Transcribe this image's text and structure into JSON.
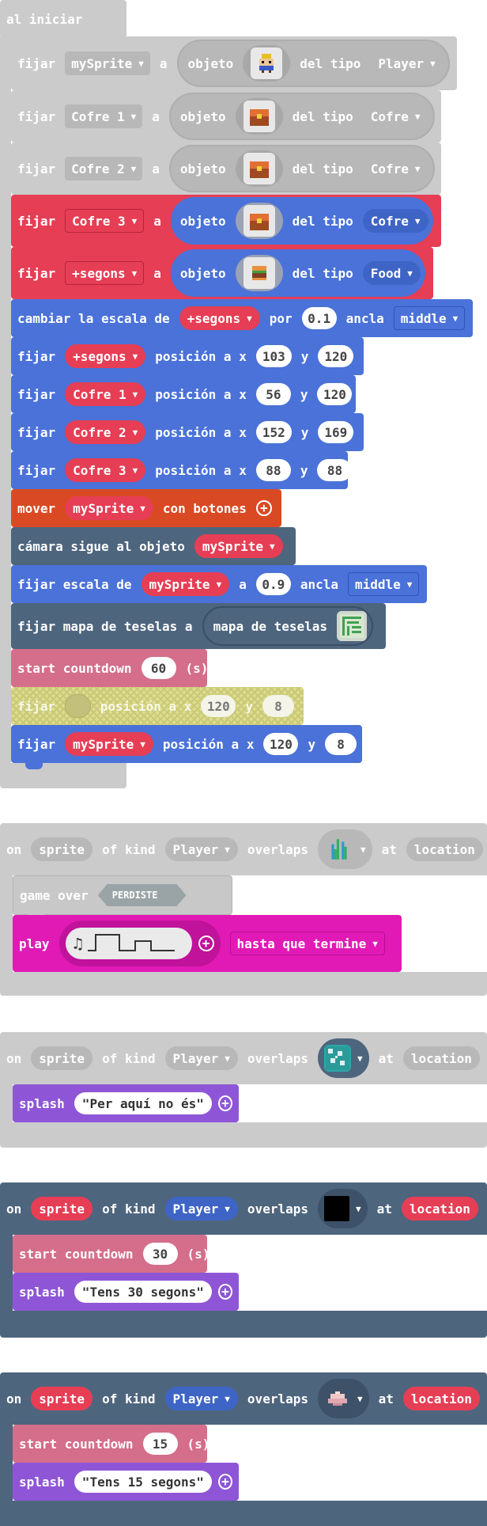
{
  "theme": {
    "disabled_gray": "#cbcbcb",
    "sprites_red": "#e63e55",
    "sprites_blue": "#4a72d8",
    "controller_orange": "#d94a24",
    "scene_slate": "#4e657e",
    "info_pink": "#d46e8a",
    "music_magenta": "#e11ab6",
    "splash_purple": "#8e56d6"
  },
  "on_start": {
    "label": "al iniciar",
    "blocks": [
      {
        "set": "fijar",
        "var": "mySprite",
        "to": "a",
        "obj": "objeto",
        "kind_label": "del tipo",
        "kind": "Player",
        "image": "player-sprite-icon"
      },
      {
        "set": "fijar",
        "var": "Cofre 1",
        "to": "a",
        "obj": "objeto",
        "kind_label": "del tipo",
        "kind": "Cofre",
        "image": "chest-icon"
      },
      {
        "set": "fijar",
        "var": "Cofre 2",
        "to": "a",
        "obj": "objeto",
        "kind_label": "del tipo",
        "kind": "Cofre",
        "image": "chest-icon"
      },
      {
        "set": "fijar",
        "var": "Cofre 3",
        "to": "a",
        "obj": "objeto",
        "kind_label": "del tipo",
        "kind": "Cofre",
        "image": "chest-icon"
      },
      {
        "set": "fijar",
        "var": "+segons",
        "to": "a",
        "obj": "objeto",
        "kind_label": "del tipo",
        "kind": "Food",
        "image": "burger-icon"
      }
    ],
    "scale": {
      "label": "cambiar la escala de",
      "var": "+segons",
      "by": "por",
      "value": "0.1",
      "anchor_label": "ancla",
      "anchor": "middle"
    },
    "positions": [
      {
        "set": "fijar",
        "var": "+segons",
        "label": "posición a x",
        "x": "103",
        "y_label": "y",
        "y": "120"
      },
      {
        "set": "fijar",
        "var": "Cofre 1",
        "label": "posición a x",
        "x": "56",
        "y_label": "y",
        "y": "120"
      },
      {
        "set": "fijar",
        "var": "Cofre 2",
        "label": "posición a x",
        "x": "152",
        "y_label": "y",
        "y": "169"
      },
      {
        "set": "fijar",
        "var": "Cofre 3",
        "label": "posición a x",
        "x": "88",
        "y_label": "y",
        "y": "88"
      }
    ],
    "move": {
      "label": "mover",
      "var": "mySprite",
      "suffix": "con botones"
    },
    "camera": {
      "label": "cámara sigue al objeto",
      "var": "mySprite"
    },
    "set_scale": {
      "label": "fijar escala de",
      "var": "mySprite",
      "to": "a",
      "value": "0.9",
      "anchor_label": "ancla",
      "anchor": "middle"
    },
    "tilemap": {
      "label": "fijar mapa de teselas a",
      "inner": "mapa de teselas"
    },
    "countdown": {
      "label": "start countdown",
      "value": "60",
      "unit": "(s)"
    },
    "disabled_pos": {
      "set": "fijar",
      "label": "posición a x",
      "x": "120",
      "y_label": "y",
      "y": "8"
    },
    "last_pos": {
      "set": "fijar",
      "var": "mySprite",
      "label": "posición a x",
      "x": "120",
      "y_label": "y",
      "y": "8"
    }
  },
  "events": [
    {
      "on": "on",
      "sprite": "sprite",
      "of_kind": "of kind",
      "kind": "Player",
      "overlaps": "overlaps",
      "at": "at",
      "location": "location",
      "tile": "seaweed-tile-icon",
      "game_over": {
        "label": "game over",
        "value": "PERDISTE"
      },
      "play": {
        "label": "play",
        "until": "hasta que termine"
      }
    },
    {
      "on": "on",
      "sprite": "sprite",
      "of_kind": "of kind",
      "kind": "Player",
      "overlaps": "overlaps",
      "at": "at",
      "location": "location",
      "tile": "dungeon-tile-icon",
      "splash": {
        "label": "splash",
        "text": "Per aquí no és"
      }
    },
    {
      "on": "on",
      "sprite": "sprite",
      "of_kind": "of kind",
      "kind": "Player",
      "overlaps": "overlaps",
      "at": "at",
      "location": "location",
      "tile": "black-tile-icon",
      "countdown": {
        "label": "start countdown",
        "value": "30",
        "unit": "(s)"
      },
      "splash": {
        "label": "splash",
        "text": "Tens 30 segons"
      }
    },
    {
      "on": "on",
      "sprite": "sprite",
      "of_kind": "of kind",
      "kind": "Player",
      "overlaps": "overlaps",
      "at": "at",
      "location": "location",
      "tile": "shell-tile-icon",
      "countdown": {
        "label": "start countdown",
        "value": "15",
        "unit": "(s)"
      },
      "splash": {
        "label": "splash",
        "text": "Tens 15 segons"
      }
    }
  ]
}
